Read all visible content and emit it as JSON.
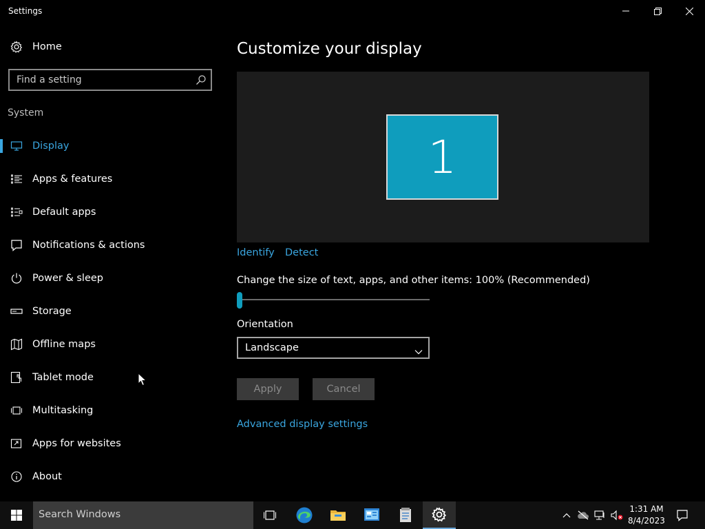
{
  "window": {
    "title": "Settings"
  },
  "sidebar": {
    "home_label": "Home",
    "search_placeholder": "Find a setting",
    "section_label": "System",
    "items": [
      {
        "label": "Display",
        "icon": "monitor-icon",
        "active": true
      },
      {
        "label": "Apps & features",
        "icon": "list-icon"
      },
      {
        "label": "Default apps",
        "icon": "default-apps-icon"
      },
      {
        "label": "Notifications & actions",
        "icon": "message-icon"
      },
      {
        "label": "Power & sleep",
        "icon": "power-icon"
      },
      {
        "label": "Storage",
        "icon": "drive-icon"
      },
      {
        "label": "Offline maps",
        "icon": "map-icon"
      },
      {
        "label": "Tablet mode",
        "icon": "tablet-icon"
      },
      {
        "label": "Multitasking",
        "icon": "multitask-icon"
      },
      {
        "label": "Apps for websites",
        "icon": "web-link-icon"
      },
      {
        "label": "About",
        "icon": "info-icon"
      }
    ]
  },
  "main": {
    "title": "Customize your display",
    "monitor_number": "1",
    "identify_label": "Identify",
    "detect_label": "Detect",
    "scale_label": "Change the size of text, apps, and other items: 100% (Recommended)",
    "scale_slider_value": 0,
    "orientation_label": "Orientation",
    "orientation_value": "Landscape",
    "apply_label": "Apply",
    "cancel_label": "Cancel",
    "advanced_label": "Advanced display settings"
  },
  "taskbar": {
    "search_text": "Search Windows",
    "time": "1:31 AM",
    "date": "8/4/2023"
  },
  "colors": {
    "accent": "#3aa6e0",
    "monitor": "#0f9dbd"
  }
}
